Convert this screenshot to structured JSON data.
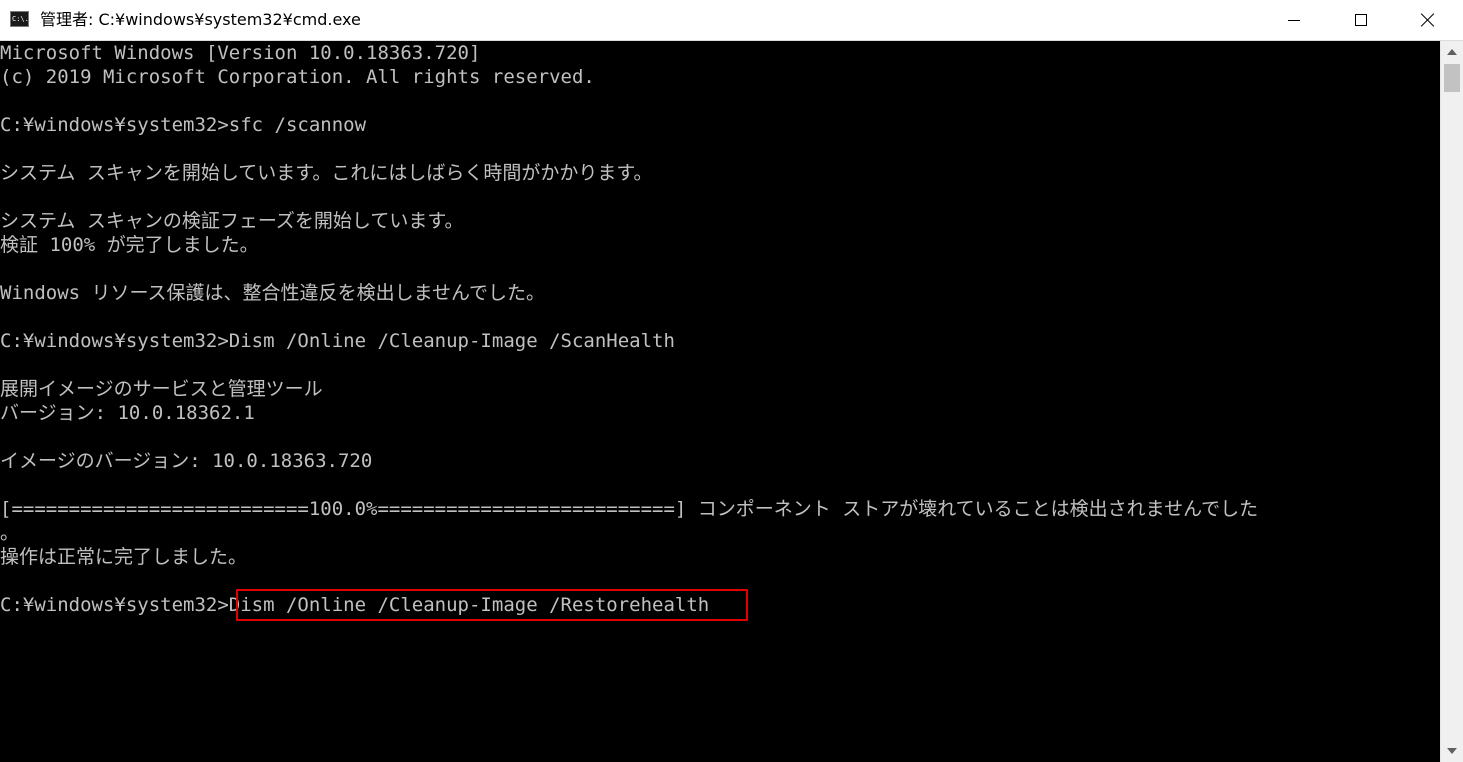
{
  "window": {
    "title": "管理者: C:¥windows¥system32¥cmd.exe",
    "app_icon_text": "C:\\.",
    "icons": {
      "app": "cmd-icon",
      "minimize": "minimize-icon",
      "maximize": "maximize-icon",
      "close": "close-icon",
      "scroll_up": "scroll-up-arrow-icon",
      "scroll_down": "scroll-down-arrow-icon"
    }
  },
  "console": {
    "colors": {
      "background": "#000000",
      "text": "#c0c0c0",
      "highlight_border": "#e00000"
    },
    "lines": [
      "Microsoft Windows [Version 10.0.18363.720]",
      "(c) 2019 Microsoft Corporation. All rights reserved.",
      "",
      "C:¥windows¥system32>sfc /scannow",
      "",
      "システム スキャンを開始しています。これにはしばらく時間がかかります。",
      "",
      "システム スキャンの検証フェーズを開始しています。",
      "検証 100% が完了しました。",
      "",
      "Windows リソース保護は、整合性違反を検出しませんでした。",
      "",
      "C:¥windows¥system32>Dism /Online /Cleanup-Image /ScanHealth",
      "",
      "展開イメージのサービスと管理ツール",
      "バージョン: 10.0.18362.1",
      "",
      "イメージのバージョン: 10.0.18363.720",
      "",
      "[==========================100.0%==========================] コンポーネント ストアが壊れていることは検出されませんでした",
      "。",
      "操作は正常に完了しました。",
      "",
      "C:¥windows¥system32>Dism /Online /Cleanup-Image /Restorehealth"
    ]
  }
}
